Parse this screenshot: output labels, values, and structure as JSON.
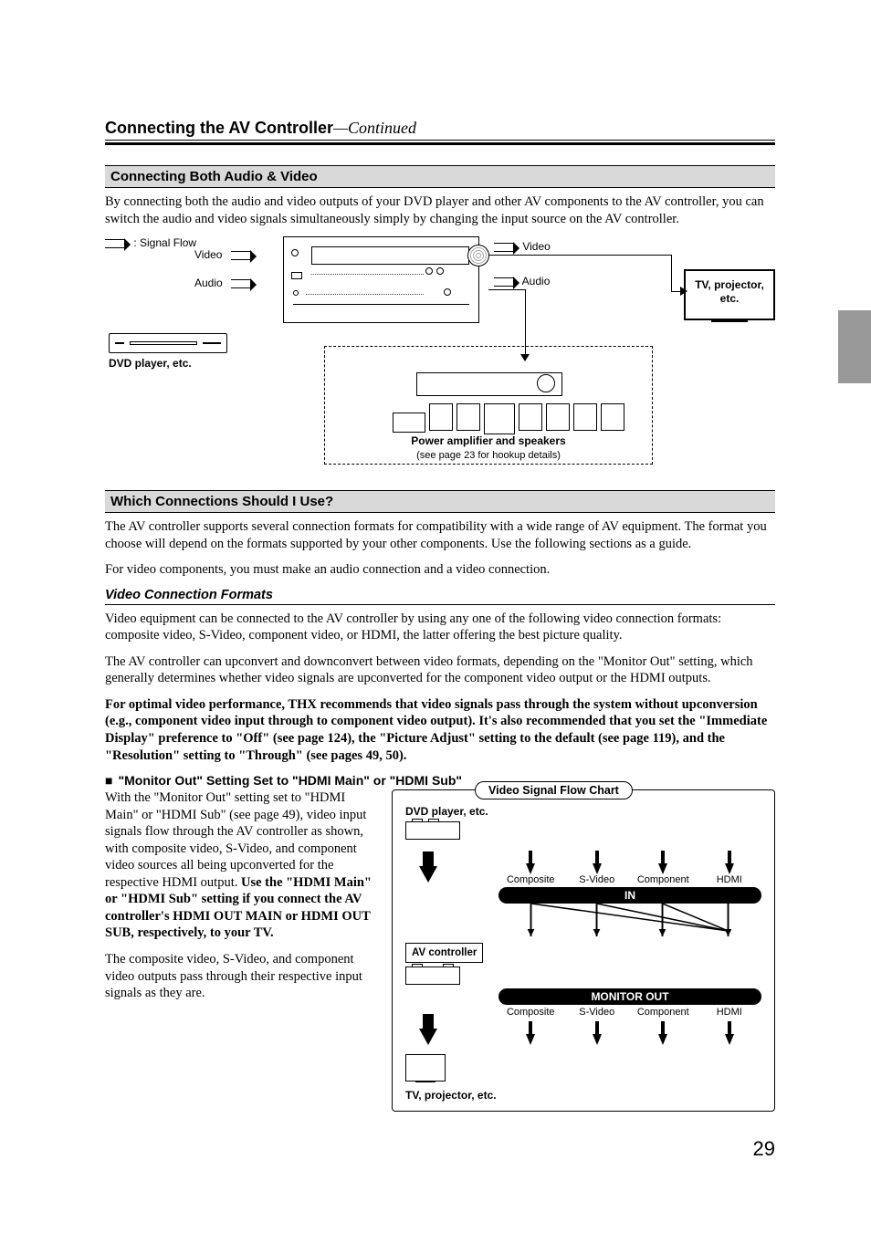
{
  "header": {
    "title_bold": "Connecting the AV Controller",
    "title_italic": "—Continued"
  },
  "section1": {
    "heading": "Connecting Both Audio & Video",
    "para": "By connecting both the audio and video outputs of your DVD player and other AV components to the AV controller, you can switch the audio and video signals simultaneously simply by changing the input source on the AV controller."
  },
  "diagram1": {
    "signal_flow": ": Signal Flow",
    "video": "Video",
    "audio": "Audio",
    "dvd_label": "DVD player, etc.",
    "tv_label_l1": "TV, projector,",
    "tv_label_l2": "etc.",
    "dashed_caption1": "Power amplifier and speakers",
    "dashed_caption2": "(see page 23 for hookup details)"
  },
  "section2": {
    "heading": "Which Connections Should I Use?",
    "para1": "The AV controller supports several connection formats for compatibility with a wide range of AV equipment. The format you choose will depend on the formats supported by your other components. Use the following sections as a guide.",
    "para2": "For video components, you must make an audio connection and a video connection."
  },
  "vcf": {
    "heading": "Video Connection Formats",
    "para1": "Video equipment can be connected to the AV controller by using any one of the following video connection formats: composite video, S-Video, component video, or HDMI, the latter offering the best picture quality.",
    "para2": "The AV controller can upconvert and downconvert between video formats, depending on the \"Monitor Out\" setting, which generally determines whether video signals are upconverted for the component video output or the HDMI outputs.",
    "para3": "For optimal video performance, THX recommends that video signals pass through the system without upconversion (e.g., component video input through to component video output). It's also recommended that you set the \"Immediate Display\" preference to \"Off\" (see page 124), the \"Picture Adjust\" setting to the default (see page 119), and the \"Resolution\" setting to \"Through\" (see pages 49, 50)."
  },
  "monitor_out": {
    "heading": "\"Monitor Out\" Setting Set to \"HDMI Main\" or \"HDMI Sub\"",
    "para1_a": "With the \"Monitor Out\" setting set to \"HDMI Main\" or \"HDMI Sub\" (see page 49), video input signals flow through the AV controller as shown, with composite video, S-Video, and component video sources all being upconverted for the respective HDMI output. ",
    "para1_b": "Use the \"HDMI Main\" or \"HDMI Sub\" setting if you connect the AV controller's HDMI OUT MAIN or HDMI OUT SUB, respectively, to your TV.",
    "para2": "The composite video, S-Video, and component video outputs pass through their respective input signals as they are."
  },
  "chart": {
    "title": "Video Signal Flow Chart",
    "dvd": "DVD player, etc.",
    "avc": "AV controller",
    "tv": "TV, projector, etc.",
    "in": "IN",
    "out": "MONITOR OUT",
    "sig1": "Composite",
    "sig2": "S-Video",
    "sig3": "Component",
    "sig4": "HDMI"
  },
  "chart_data": {
    "type": "diagram",
    "title": "Video Signal Flow Chart",
    "nodes": [
      "DVD player, etc.",
      "AV controller",
      "TV, projector, etc."
    ],
    "inputs": [
      "Composite",
      "S-Video",
      "Component",
      "HDMI"
    ],
    "in_bar": "IN",
    "outputs": [
      "Composite",
      "S-Video",
      "Component",
      "HDMI"
    ],
    "out_bar": "MONITOR OUT",
    "upconversion_target": "HDMI",
    "passthrough": [
      "Composite",
      "S-Video",
      "Component"
    ]
  },
  "page_number": "29"
}
